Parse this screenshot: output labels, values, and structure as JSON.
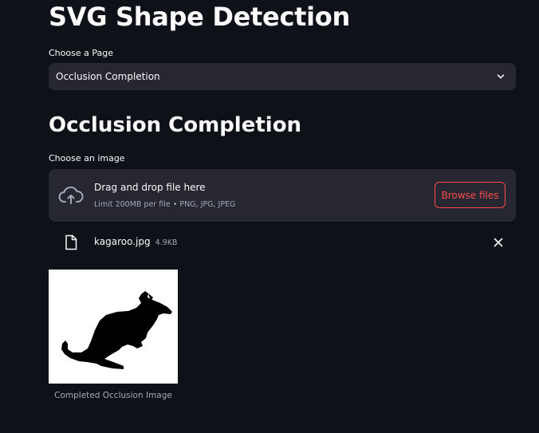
{
  "app": {
    "title": "SVG Shape Detection"
  },
  "page_select": {
    "label": "Choose a Page",
    "selected": "Occlusion Completion",
    "icon": "chevron-down-icon"
  },
  "section": {
    "title": "Occlusion Completion"
  },
  "uploader": {
    "label": "Choose an image",
    "drop_title": "Drag and drop file here",
    "drop_limits": "Limit 200MB per file • PNG, JPG, JPEG",
    "browse_label": "Browse files",
    "accent_color": "#ff4b4b",
    "icon": "cloud-upload-icon"
  },
  "uploaded_file": {
    "name": "kagaroo.jpg",
    "size": "4.9KB",
    "icon": "file-icon",
    "delete_icon": "close-icon"
  },
  "result": {
    "caption": "Completed Occlusion Image"
  },
  "theme": {
    "background": "#0e1117",
    "widget_background": "#262730",
    "text": "#fafafa"
  }
}
